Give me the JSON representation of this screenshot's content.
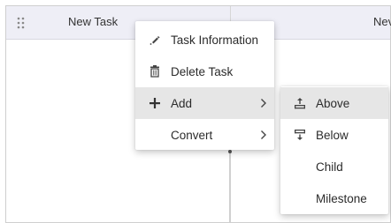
{
  "grid": {
    "header": {
      "drag_handle_icon": "drag-handle-icon",
      "task_name": "New Task",
      "second_column": "Nev"
    }
  },
  "context_menu": {
    "items": [
      {
        "label": "Task Information",
        "icon": "pen-icon",
        "has_submenu": false
      },
      {
        "label": "Delete Task",
        "icon": "trash-icon",
        "has_submenu": false
      },
      {
        "label": "Add",
        "icon": "plus-icon",
        "has_submenu": true,
        "active": true
      },
      {
        "label": "Convert",
        "icon": "",
        "has_submenu": true
      }
    ]
  },
  "sub_menu": {
    "items": [
      {
        "label": "Above",
        "icon": "insert-above-icon",
        "active": true
      },
      {
        "label": "Below",
        "icon": "insert-below-icon"
      },
      {
        "label": "Child",
        "icon": ""
      },
      {
        "label": "Milestone",
        "icon": ""
      }
    ]
  },
  "colors": {
    "header_bg": "#eeeef6",
    "active_item_bg": "#e6e6e6",
    "text": "#2b2b2b"
  }
}
